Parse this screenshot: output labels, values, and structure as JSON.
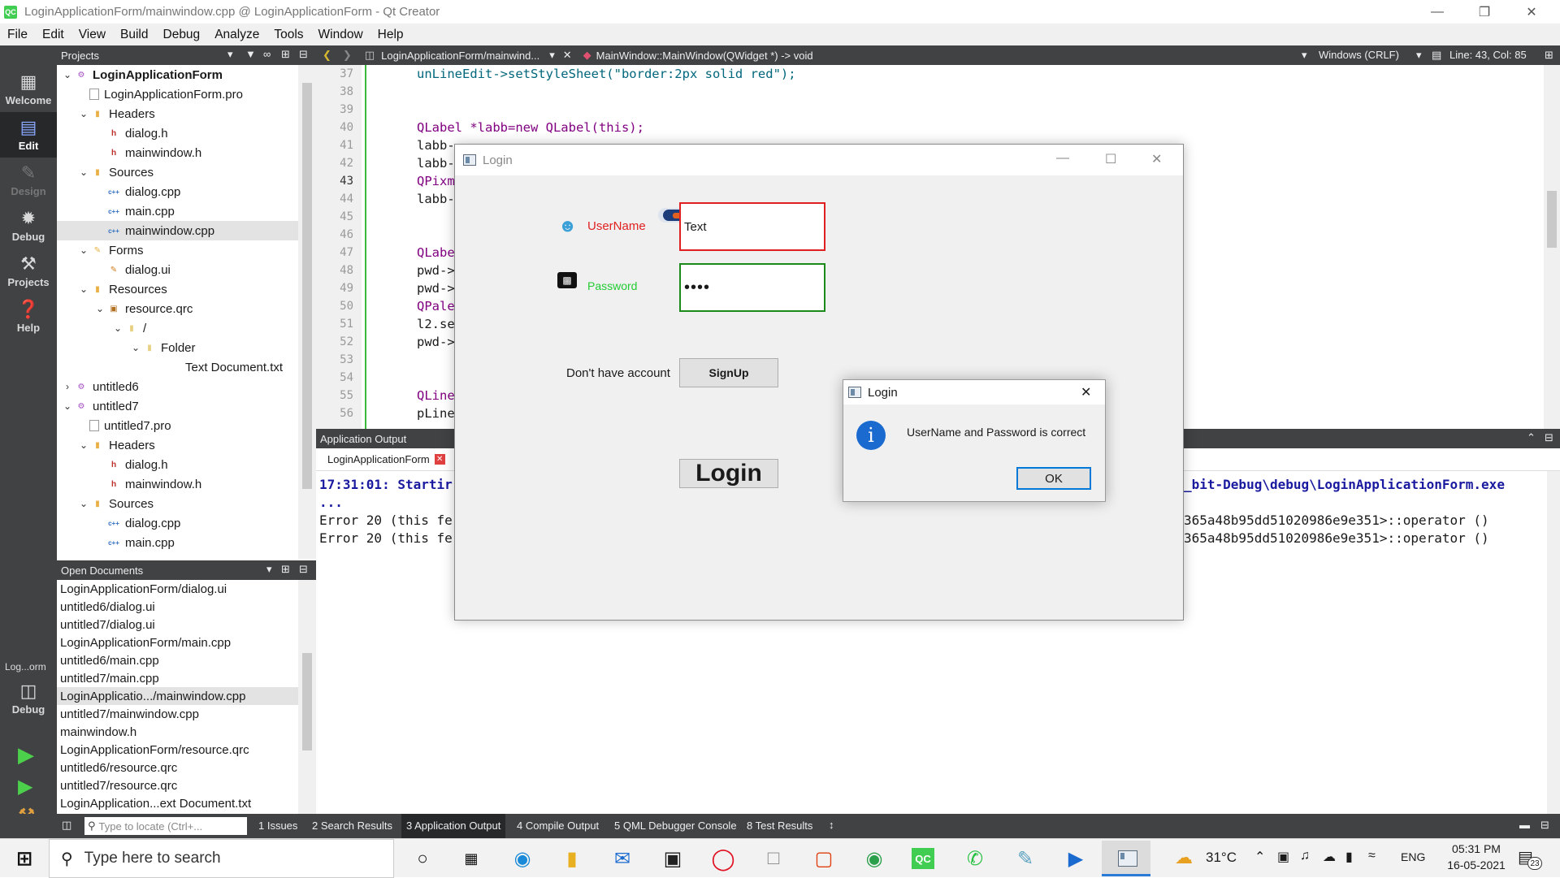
{
  "window": {
    "title": "LoginApplicationForm/mainwindow.cpp @ LoginApplicationForm - Qt Creator",
    "app_icon": "QC"
  },
  "menu": [
    "File",
    "Edit",
    "View",
    "Build",
    "Debug",
    "Analyze",
    "Tools",
    "Window",
    "Help"
  ],
  "modes": [
    {
      "label": "Welcome",
      "icon": "grid-icon"
    },
    {
      "label": "Edit",
      "icon": "edit-icon",
      "active": true
    },
    {
      "label": "Design",
      "icon": "pencil-icon",
      "disabled": true
    },
    {
      "label": "Debug",
      "icon": "bug-icon"
    },
    {
      "label": "Projects",
      "icon": "wrench-icon"
    },
    {
      "label": "Help",
      "icon": "help-icon"
    }
  ],
  "kit_selector": {
    "project": "Log...orm",
    "mode": "Debug"
  },
  "projects_panel": {
    "title": "Projects",
    "tree": [
      "LoginApplicationForm",
      "LoginApplicationForm.pro",
      "Headers",
      "dialog.h",
      "mainwindow.h",
      "Sources",
      "dialog.cpp",
      "main.cpp",
      "mainwindow.cpp",
      "Forms",
      "dialog.ui",
      "Resources",
      "resource.qrc",
      "/",
      "Folder",
      "Text Document.txt",
      "untitled6",
      "untitled7",
      "untitled7.pro",
      "Headers",
      "dialog.h",
      "mainwindow.h",
      "Sources",
      "dialog.cpp",
      "main.cpp"
    ]
  },
  "open_documents": {
    "title": "Open Documents",
    "items": [
      "LoginApplicationForm/dialog.ui",
      "untitled6/dialog.ui",
      "untitled7/dialog.ui",
      "LoginApplicationForm/main.cpp",
      "untitled6/main.cpp",
      "untitled7/main.cpp",
      "LoginApplicatio.../mainwindow.cpp",
      "untitled7/mainwindow.cpp",
      "mainwindow.h",
      "LoginApplicationForm/resource.qrc",
      "untitled6/resource.qrc",
      "untitled7/resource.qrc",
      "LoginApplication...ext Document.txt"
    ],
    "selected_index": 6
  },
  "editor": {
    "file_tab": "LoginApplicationForm/mainwind...",
    "symbol": "MainWindow::MainWindow(QWidget *) -> void",
    "line_ending": "Windows (CRLF)",
    "position": "Line: 43, Col: 85",
    "current_line": "43",
    "line_numbers": [
      "37",
      "38",
      "39",
      "40",
      "41",
      "42",
      "43",
      "44",
      "45",
      "46",
      "47",
      "48",
      "49",
      "50",
      "51",
      "52",
      "53",
      "54",
      "55",
      "56"
    ],
    "lines": {
      "l37": "unLineEdit->setStyleSheet(\"border:2px solid red\");",
      "l40": "QLabel *labb=new QLabel(this);",
      "l41": "labb-",
      "l42": "labb-",
      "l43": "QPixm",
      "l44": "labb-",
      "l47": "QLabe",
      "l48": "pwd->",
      "l49": "pwd->",
      "l50": "QPale",
      "l51": "l2.se",
      "l52": "pwd->",
      "l55": "QLine",
      "l56": "pLine"
    }
  },
  "output": {
    "title": "Application Output",
    "tab": "LoginApplicationForm",
    "lines": [
      "17:31:01: Startir",
      "...",
      "Error 20 (this fe",
      "Error 20 (this fe"
    ],
    "right_lines": [
      "_bit-Debug\\debug\\LoginApplicationForm.exe",
      "365a48b95dd51020986e9e351>::operator ()",
      "365a48b95dd51020986e9e351>::operator ()"
    ]
  },
  "status_bar": {
    "locator_placeholder": "Type to locate (Ctrl+...",
    "tabs": [
      "1 Issues",
      "2 Search Results",
      "3 Application Output",
      "4 Compile Output",
      "5 QML Debugger Console",
      "8 Test Results"
    ]
  },
  "login_window": {
    "title": "Login",
    "username_label": "UserName",
    "username_value": "Text",
    "password_label": "Password",
    "password_value": "••••",
    "no_account_text": "Don't have account",
    "signup_button": "SignUp",
    "login_button": "Login",
    "colors": {
      "username_border": "#e02020",
      "password_border": "#1a8a1a",
      "username_label": "#e02020",
      "password_label": "#22cc33"
    }
  },
  "message_box": {
    "title": "Login",
    "message": "UserName and Password is correct",
    "ok_button": "OK",
    "icon": "info-icon"
  },
  "taskbar": {
    "search_placeholder": "Type here to search",
    "weather": "31°C",
    "language": "ENG",
    "time": "05:31 PM",
    "date": "16-05-2021",
    "notifications": "23"
  }
}
